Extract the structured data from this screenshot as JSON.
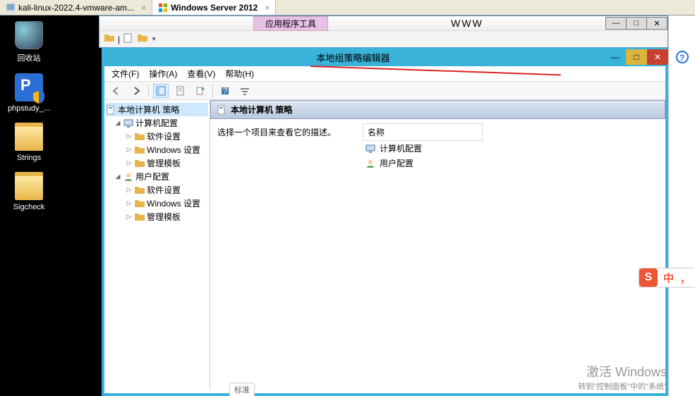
{
  "vmware": {
    "tabs": [
      {
        "label": "kali-linux-2022.4-vmware-am...",
        "close": "×"
      },
      {
        "label": "Windows Server 2012",
        "close": "×"
      }
    ]
  },
  "desktop": {
    "icons": {
      "recycle": "回收站",
      "phpstudy": "phpstudy_...",
      "strings": "Strings",
      "sigcheck": "Sigcheck"
    }
  },
  "explorer": {
    "contextual_tab": "应用程序工具",
    "title": "WWW",
    "controls": {
      "min": "—",
      "max": "□",
      "close": "✕"
    }
  },
  "mmc": {
    "title": "本地组策略编辑器",
    "controls": {
      "min": "—",
      "max": "□",
      "close": "✕"
    },
    "menu": {
      "file": "文件(F)",
      "action": "操作(A)",
      "view": "查看(V)",
      "help": "帮助(H)"
    },
    "tree": {
      "root": "本地计算机 策略",
      "comp": "计算机配置",
      "comp_soft": "软件设置",
      "comp_win": "Windows 设置",
      "comp_admin": "管理模板",
      "user": "用户配置",
      "user_soft": "软件设置",
      "user_win": "Windows 设置",
      "user_admin": "管理模板"
    },
    "detail": {
      "header": "本地计算机 策略",
      "hint": "选择一个项目来查看它的描述。",
      "col_name": "名称",
      "items": {
        "comp": "计算机配置",
        "user": "用户配置"
      }
    },
    "bottom_tab": "标准"
  },
  "ime": {
    "logo": "S",
    "lang": "中"
  },
  "watermark": {
    "line1": "激活 Windows",
    "line2": "转到\"控制面板\"中的\"系统\""
  },
  "help": "?"
}
